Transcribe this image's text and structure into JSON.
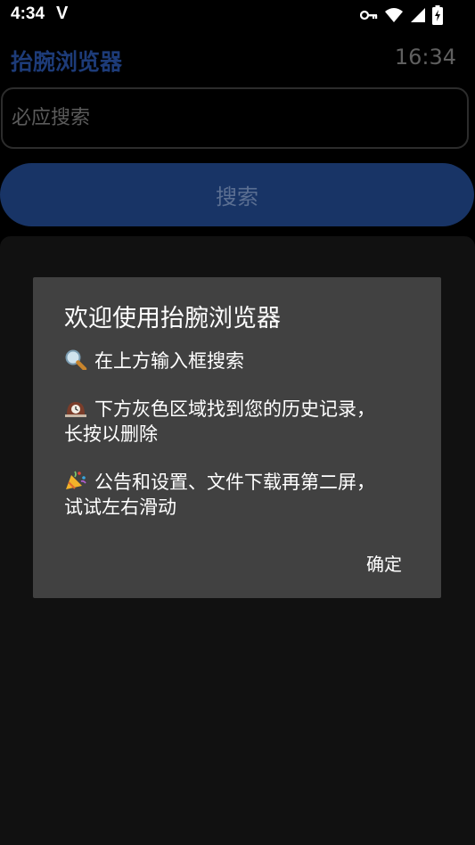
{
  "status_bar": {
    "time": "4:34",
    "carrier_glyph": "V",
    "icons": [
      "key-icon",
      "wifi-icon",
      "signal-icon",
      "battery-charging-icon"
    ]
  },
  "header": {
    "app_title": "抬腕浏览器",
    "clock": "16:34"
  },
  "search": {
    "placeholder": "必应搜索",
    "value": "",
    "button_label": "搜索"
  },
  "dialog": {
    "title": "欢迎使用抬腕浏览器",
    "lines": [
      {
        "icon": "magnifier-icon",
        "text": "在上方输入框搜索"
      },
      {
        "icon": "clock-icon",
        "text": "下方灰色区域找到您的历史记录，长按以删除"
      },
      {
        "icon": "party-popper-icon",
        "text": "公告和设置、文件下载再第二屏，试试左右滑动"
      }
    ],
    "ok_label": "确定"
  },
  "colors": {
    "background": "#000000",
    "title_accent": "#1d3b78",
    "search_button": "#183466",
    "history_panel": "#111111",
    "dialog_bg": "#414141"
  }
}
